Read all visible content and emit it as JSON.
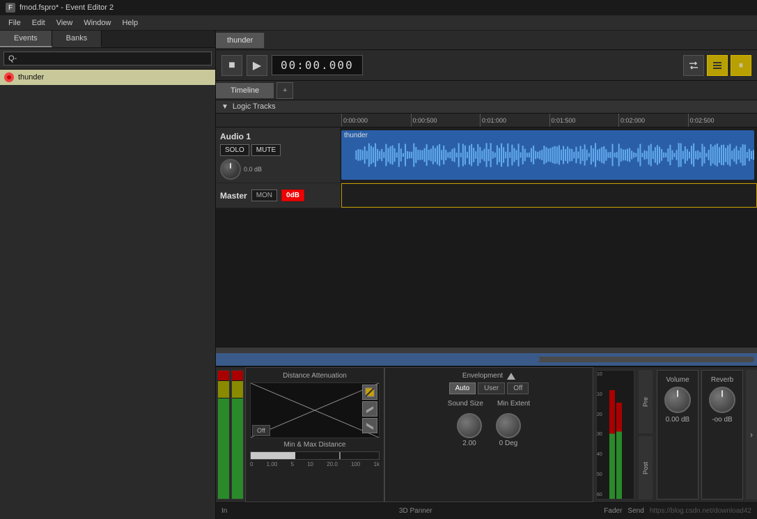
{
  "titleBar": {
    "icon": "F",
    "title": "fmod.fspro* - Event Editor 2"
  },
  "menuBar": {
    "items": [
      "File",
      "Edit",
      "View",
      "Window",
      "Help"
    ]
  },
  "leftPanel": {
    "tabs": [
      "Events",
      "Banks"
    ],
    "activeTab": "Events",
    "searchPlaceholder": "Q-",
    "events": [
      {
        "name": "thunder",
        "selected": true
      }
    ]
  },
  "eventTab": {
    "label": "thunder"
  },
  "transport": {
    "stopLabel": "■",
    "playLabel": "▶",
    "timeDisplay": "00:00.000",
    "loopIcon": "⇄",
    "gridIcon": "≣",
    "pauseIcon": "⏸"
  },
  "timeline": {
    "tabs": [
      "Timeline"
    ],
    "addBtn": "+",
    "logicTracks": {
      "arrow": "▼",
      "label": "Logic Tracks"
    },
    "ruler": {
      "marks": [
        "0:00:000",
        "0:00:500",
        "0:01:000",
        "0:01:500",
        "0:02:000",
        "0:02:500"
      ]
    }
  },
  "tracks": [
    {
      "name": "Audio 1",
      "soloLabel": "SOLO",
      "muteLabel": "MUTE",
      "knobValue": "0.0 dB",
      "clipName": "thunder"
    }
  ],
  "masterTrack": {
    "name": "Master",
    "monLabel": "MON",
    "dbLabel": "0dB"
  },
  "panner": {
    "distAttenuation": {
      "title": "Distance Attenuation",
      "offLabel": "Off",
      "minMaxLabel": "Min & Max Distance",
      "minValue": "1.00",
      "distanceMarks": [
        "0",
        "1.00",
        "5",
        "10",
        "20.0",
        "100",
        "1k"
      ]
    },
    "envelopment": {
      "title": "Envelopment",
      "triangleUp": true,
      "autoLabel": "Auto",
      "userLabel": "User",
      "offLabel": "Off",
      "soundSizeLabel": "Sound Size",
      "minExtentLabel": "Min Extent",
      "soundSizeValue": "2.00",
      "minExtentValue": "0 Deg"
    },
    "preLabel": "Pre",
    "postLabel": "Post",
    "volume": {
      "title": "Volume",
      "value": "0.00 dB"
    },
    "reverb": {
      "title": "Reverb",
      "value": "-oo dB"
    },
    "faderLabel": "Fader",
    "sendLabel": "Send",
    "inLabel": "In",
    "panner3DLabel": "3D Panner"
  },
  "statusBar": {
    "url": "https://blog.csdn.net/download42"
  },
  "colors": {
    "accent": "#c8a000",
    "trackBlue": "#2a5fa8",
    "activeRed": "#e00000",
    "selectedItem": "#c8c89a"
  }
}
